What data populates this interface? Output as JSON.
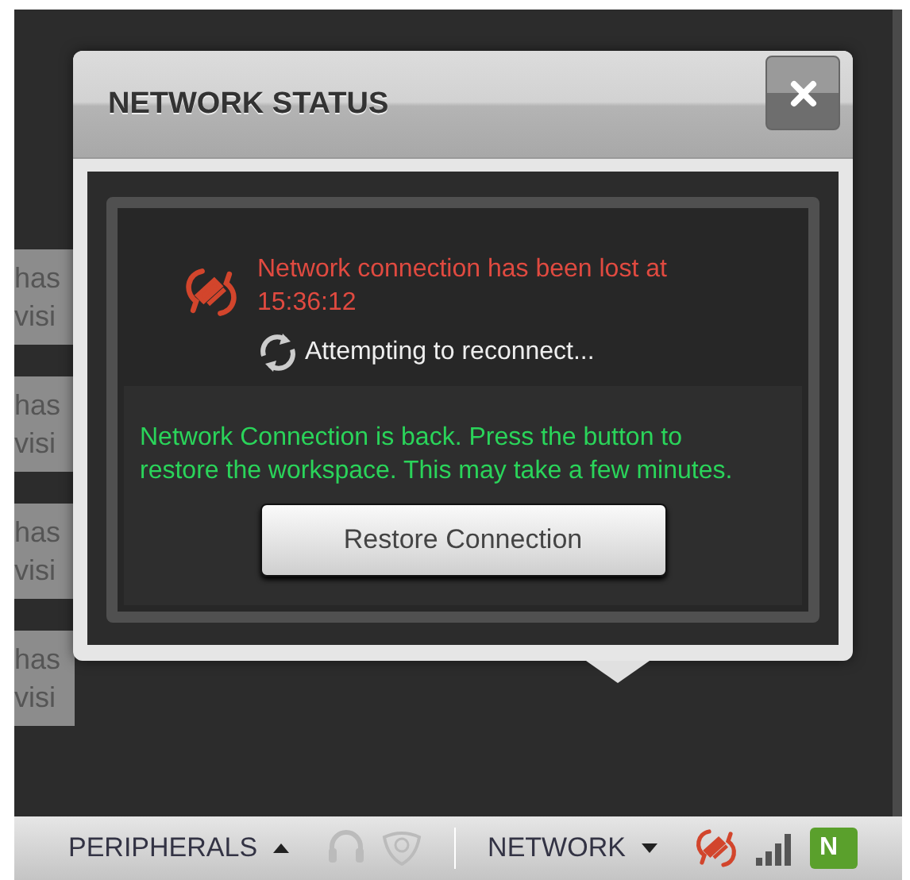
{
  "background_cards": [
    {
      "line_1": "has",
      "line_2": "visi"
    },
    {
      "line_1": "has",
      "line_2": "visi"
    },
    {
      "line_1": "has",
      "line_2": "visi"
    },
    {
      "line_1": "has",
      "line_2": "visi"
    }
  ],
  "dialog": {
    "title": "NETWORK STATUS",
    "lost_message": "Network connection has been lost at 15:36:12",
    "reconnect_status": "Attempting to reconnect...",
    "back_message": "Network Connection is back. Press the button to restore the workspace. This may take a few minutes.",
    "restore_button": "Restore Connection"
  },
  "status_bar": {
    "peripherals": "PERIPHERALS",
    "network": "NETWORK",
    "badge": "N"
  }
}
